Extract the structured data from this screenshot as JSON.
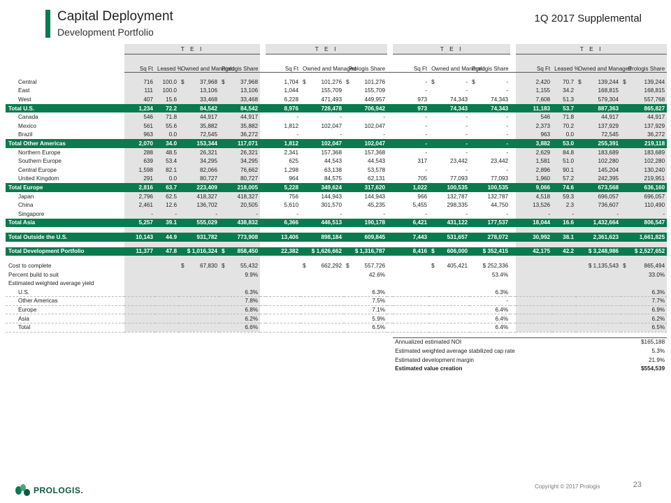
{
  "header": {
    "title": "Capital Deployment",
    "subtitle": "Development Portfolio",
    "supplemental": "1Q 2017 Supplemental"
  },
  "colors": {
    "brand_green": "#0a7a4f",
    "header_gray": "#e3e3e3"
  },
  "table": {
    "tei": [
      "T E I",
      "T E I",
      "T E I",
      "T E I"
    ],
    "col_headers": [
      {
        "g1": [
          "Sq Ft",
          "Leased %",
          "Owned and Managed",
          "Prologis Share"
        ]
      },
      {
        "g2": [
          "Sq Ft",
          "Owned and Managed",
          "Prologis Share"
        ]
      },
      {
        "g3": [
          "Sq Ft",
          "Owned and Managed",
          "Prologis Share"
        ]
      },
      {
        "g4": [
          "Sq Ft",
          "Leased %",
          "Owned and Managed",
          "Prologis Share"
        ]
      }
    ],
    "rows": [
      {
        "label": "Central",
        "type": "item",
        "cells": [
          "716",
          "100.0",
          "$|37,968",
          "$|37,968",
          "1,704",
          "$|101,276",
          "$|101,276",
          "-",
          "$|-",
          "$|-",
          "2,420",
          "70.7",
          "$|139,244",
          "$|139,244"
        ]
      },
      {
        "label": "East",
        "type": "item",
        "cells": [
          "111",
          "100.0",
          "13,106",
          "13,106",
          "1,044",
          "155,709",
          "155,709",
          "-",
          "-",
          "-",
          "1,155",
          "34.2",
          "168,815",
          "168,815"
        ]
      },
      {
        "label": "West",
        "type": "item",
        "cells": [
          "407",
          "15.6",
          "33,468",
          "33,468",
          "6,228",
          "471,493",
          "449,957",
          "973",
          "74,343",
          "74,343",
          "7,608",
          "51.3",
          "579,304",
          "557,768"
        ]
      },
      {
        "label": "Total U.S.",
        "type": "total",
        "cells": [
          "1,234",
          "72.2",
          "84,542",
          "84,542",
          "8,976",
          "728,478",
          "706,942",
          "973",
          "74,343",
          "74,343",
          "11,183",
          "53.7",
          "887,363",
          "865,827"
        ]
      },
      {
        "label": "Canada",
        "type": "item",
        "cells": [
          "546",
          "71.8",
          "44,917",
          "44,917",
          "-",
          "-",
          "-",
          "-",
          "-",
          "-",
          "546",
          "71.8",
          "44,917",
          "44,917"
        ]
      },
      {
        "label": "Mexico",
        "type": "item",
        "cells": [
          "561",
          "55.6",
          "35,882",
          "35,882",
          "1,812",
          "102,047",
          "102,047",
          "-",
          "-",
          "-",
          "2,373",
          "70.2",
          "137,929",
          "137,929"
        ]
      },
      {
        "label": "Brazil",
        "type": "item",
        "cells": [
          "963",
          "0.0",
          "72,545",
          "36,272",
          "-",
          "-",
          "-",
          "-",
          "-",
          "-",
          "963",
          "0.0",
          "72,545",
          "36,272"
        ]
      },
      {
        "label": "Total Other Americas",
        "type": "total",
        "cells": [
          "2,070",
          "34.0",
          "153,344",
          "117,071",
          "1,812",
          "102,047",
          "102,047",
          "-",
          "-",
          "-",
          "3,882",
          "53.0",
          "255,391",
          "219,118"
        ]
      },
      {
        "label": "Northern Europe",
        "type": "item",
        "cells": [
          "288",
          "48.5",
          "26,321",
          "26,321",
          "2,341",
          "157,368",
          "157,368",
          "-",
          "-",
          "-",
          "2,629",
          "84.8",
          "183,689",
          "183,689"
        ]
      },
      {
        "label": "Southern Europe",
        "type": "item",
        "cells": [
          "639",
          "53.4",
          "34,295",
          "34,295",
          "625",
          "44,543",
          "44,543",
          "317",
          "23,442",
          "23,442",
          "1,581",
          "51.0",
          "102,280",
          "102,280"
        ]
      },
      {
        "label": "Central Europe",
        "type": "item",
        "cells": [
          "1,598",
          "82.1",
          "82,066",
          "76,662",
          "1,298",
          "63,138",
          "53,578",
          "-",
          "-",
          "-",
          "2,896",
          "90.1",
          "145,204",
          "130,240"
        ]
      },
      {
        "label": "United Kingdom",
        "type": "item",
        "cells": [
          "291",
          "0.0",
          "80,727",
          "80,727",
          "964",
          "84,575",
          "62,131",
          "705",
          "77,093",
          "77,093",
          "1,960",
          "57.2",
          "242,395",
          "219,951"
        ]
      },
      {
        "label": "Total Europe",
        "type": "total",
        "cells": [
          "2,816",
          "63.7",
          "223,409",
          "218,005",
          "5,228",
          "349,624",
          "317,620",
          "1,022",
          "100,535",
          "100,535",
          "9,066",
          "74.6",
          "673,568",
          "636,160"
        ]
      },
      {
        "label": "Japan",
        "type": "item",
        "cells": [
          "2,796",
          "62.5",
          "418,327",
          "418,327",
          "756",
          "144,943",
          "144,943",
          "966",
          "132,787",
          "132,787",
          "4,518",
          "59.3",
          "696,057",
          "696,057"
        ]
      },
      {
        "label": "China",
        "type": "item",
        "cells": [
          "2,461",
          "12.6",
          "136,702",
          "20,505",
          "5,610",
          "301,570",
          "45,235",
          "5,455",
          "298,335",
          "44,750",
          "13,526",
          "2.3",
          "736,607",
          "110,490"
        ]
      },
      {
        "label": "Singapore",
        "type": "item",
        "cells": [
          "-",
          "-",
          "-",
          "-",
          "-",
          "-",
          "-",
          "-",
          "-",
          "-",
          "-",
          "-",
          "-",
          "-"
        ]
      },
      {
        "label": "Total Asia",
        "type": "total",
        "cells": [
          "5,257",
          "39.1",
          "555,029",
          "438,832",
          "6,366",
          "446,513",
          "190,178",
          "6,421",
          "431,122",
          "177,537",
          "18,044",
          "16.6",
          "1,432,664",
          "806,547"
        ]
      },
      {
        "type": "blank"
      },
      {
        "label": "Total Outside the U.S.",
        "type": "total",
        "cells": [
          "10,143",
          "44.9",
          "931,782",
          "773,908",
          "13,406",
          "898,184",
          "609,845",
          "7,443",
          "531,657",
          "278,072",
          "30,992",
          "38.1",
          "2,361,623",
          "1,661,825"
        ]
      },
      {
        "type": "blank"
      },
      {
        "label": "Total Development Portfolio",
        "type": "total",
        "cells": [
          "11,377",
          "47.8",
          "$ 1,016,324",
          "$|858,450",
          "22,382",
          "$ 1,626,662",
          "$ 1,316,787",
          "8,416",
          "$|606,000",
          "$ 352,415",
          "42,175",
          "42.2",
          "$ 3,248,986",
          "$ 2,527,652"
        ]
      },
      {
        "type": "blank"
      },
      {
        "label": "Cost to complete",
        "type": "plain",
        "cells": [
          "",
          "",
          "$|67,830",
          "$|55,432",
          "",
          "$|662,292",
          "$|557,726",
          "",
          "$|405,421",
          "$ 252,336",
          "",
          "",
          "$ 1,135,543",
          "$|865,494"
        ]
      },
      {
        "label": "Percent build to suit",
        "type": "plain",
        "cells": [
          "",
          "",
          "",
          "9.9%",
          "",
          "",
          "42.6%",
          "",
          "",
          "53.4%",
          "",
          "",
          "",
          "33.0%"
        ]
      },
      {
        "label": "Estimated weighted average yield",
        "type": "plain",
        "cells": [
          "",
          "",
          "",
          "",
          "",
          "",
          "",
          "",
          "",
          "",
          "",
          "",
          "",
          ""
        ]
      },
      {
        "label": "U.S.",
        "type": "yield",
        "cells": [
          "",
          "",
          "",
          "6.3%",
          "",
          "",
          "6.3%",
          "",
          "",
          "6.3%",
          "",
          "",
          "",
          "6.3%"
        ]
      },
      {
        "label": "Other Americas",
        "type": "yield",
        "cells": [
          "",
          "",
          "",
          "7.8%",
          "",
          "",
          "7.5%",
          "",
          "",
          "-",
          "",
          "",
          "",
          "7.7%"
        ]
      },
      {
        "label": "Europe",
        "type": "yield",
        "cells": [
          "",
          "",
          "",
          "6.8%",
          "",
          "",
          "7.1%",
          "",
          "",
          "6.4%",
          "",
          "",
          "",
          "6.9%"
        ]
      },
      {
        "label": "Asia",
        "type": "yield",
        "cells": [
          "",
          "",
          "",
          "6.2%",
          "",
          "",
          "5.9%",
          "",
          "",
          "6.4%",
          "",
          "",
          "",
          "6.2%"
        ]
      },
      {
        "label": "Total",
        "type": "yield",
        "cells": [
          "",
          "",
          "",
          "6.6%",
          "",
          "",
          "6.5%",
          "",
          "",
          "6.4%",
          "",
          "",
          "",
          "6.5%"
        ]
      }
    ],
    "annual": [
      {
        "label": "Annualized estimated NOI",
        "value": "$165,188",
        "bold": false
      },
      {
        "label": "Estimated weighted average stabilized cap rate",
        "value": "5.3%",
        "bold": false
      },
      {
        "label": "Estimated development margin",
        "value": "21.9%",
        "bold": false
      },
      {
        "label": "Estimated value creation",
        "value": "$554,539",
        "bold": true
      }
    ]
  },
  "footer": {
    "logo_text": "PROLOGIS.",
    "copyright": "Copyright © 2017 Prologis",
    "page": "23"
  }
}
